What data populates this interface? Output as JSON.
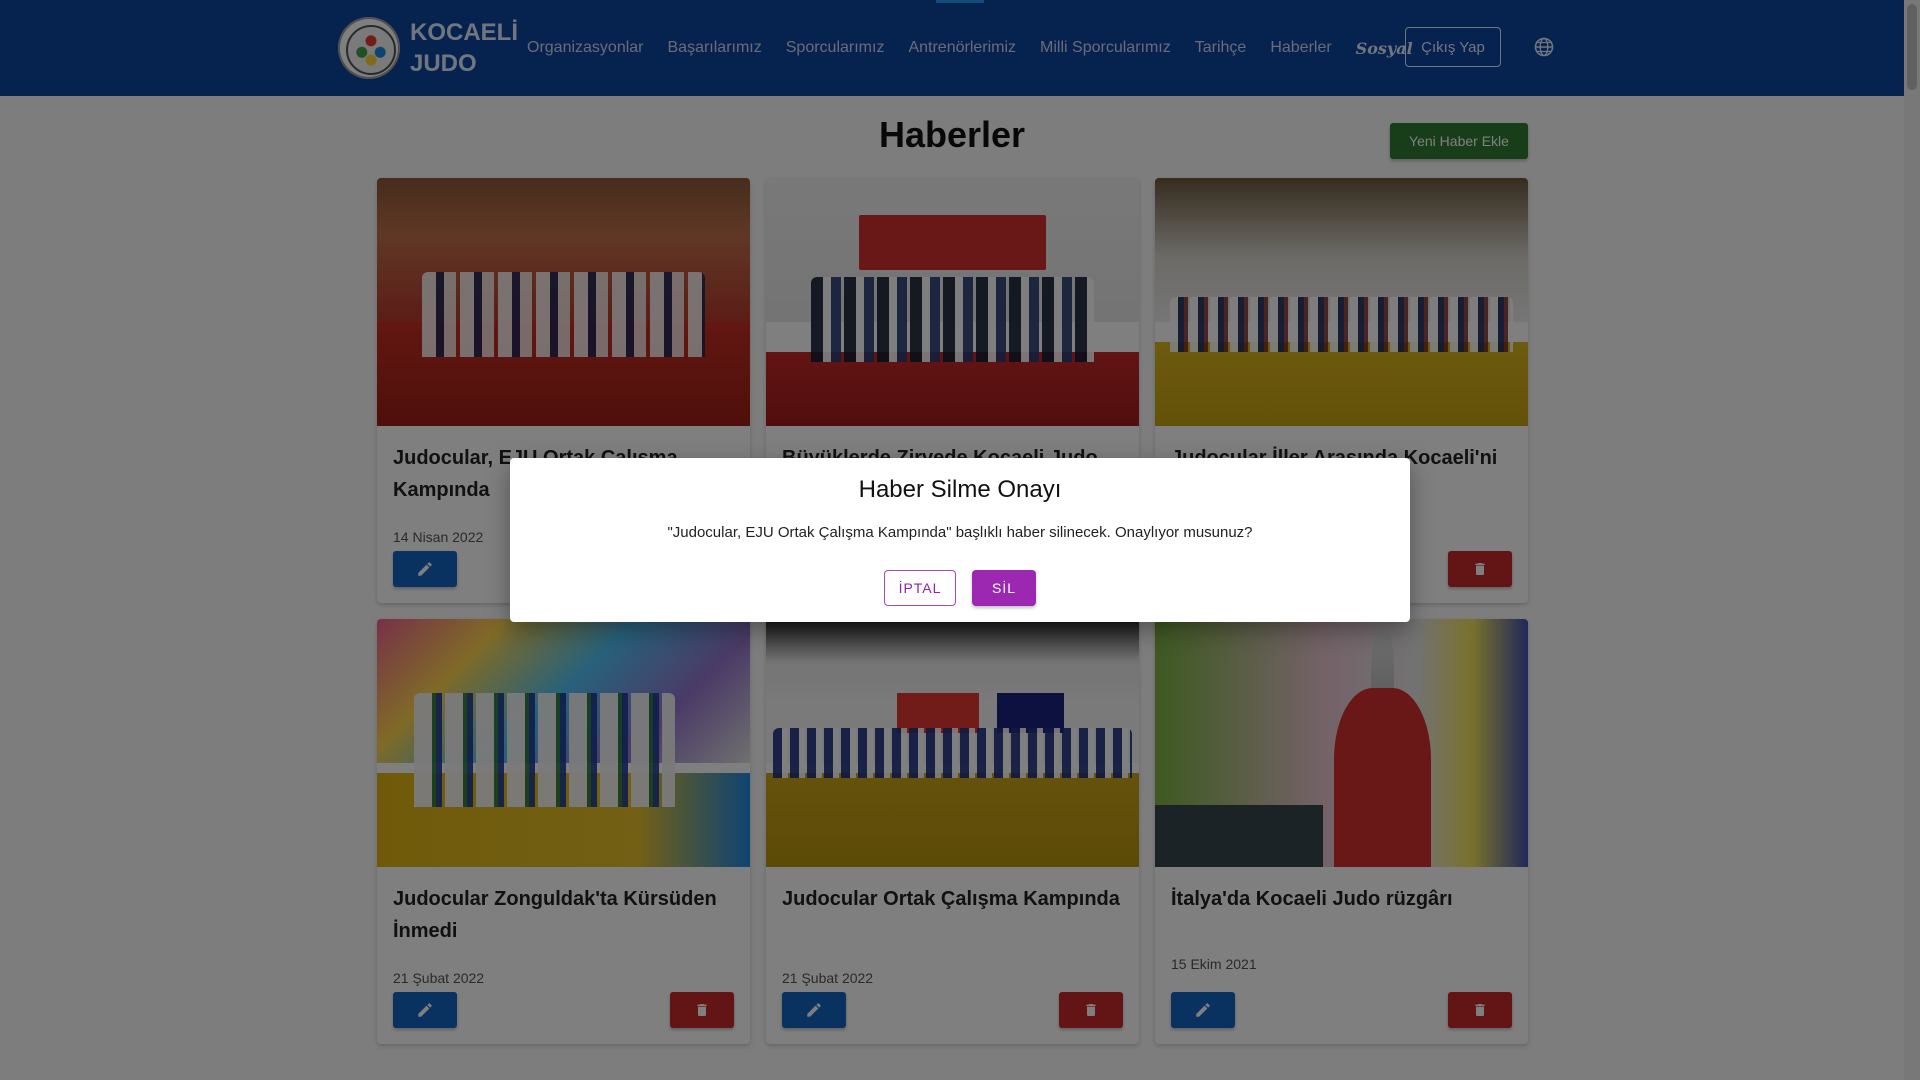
{
  "navbar": {
    "brand": "KOCAELİ\nJUDO",
    "links": [
      "Organizasyonlar",
      "Başarılarımız",
      "Sporcularımız",
      "Antrenörlerimiz",
      "Milli Sporcularımız",
      "Tarihçe",
      "Haberler",
      "Sosyal"
    ],
    "logout_label": "Çıkış Yap",
    "globe_icon": "globe-icon"
  },
  "main": {
    "title": "Haberler",
    "add_label": "Yeni Haber Ekle",
    "cards": [
      {
        "title": "Judocular, EJU Ortak Çalışma Kampında",
        "date": "14 Nisan 2022",
        "image": "red-mat-team-photo"
      },
      {
        "title": "Büyüklerde Zirvede Kocaeli Judo",
        "date": "",
        "image": "federation-banner-photo"
      },
      {
        "title": "Judocular İller Arasında Kocaeli'ni",
        "date": "",
        "image": "yellow-mat-group-photo"
      },
      {
        "title": "Judocular Zonguldak'ta Kürsüden İnmedi",
        "date": "21 Şubat 2022",
        "image": "climbing-wall-team-photo"
      },
      {
        "title": "Judocular Ortak Çalışma Kampında",
        "date": "21 Şubat 2022",
        "image": "flag-hall-group-photo"
      },
      {
        "title": "İtalya'da Kocaeli Judo rüzgârı",
        "date": "15 Ekim 2021",
        "image": "trophy-athlete-photo"
      }
    ]
  },
  "dialog": {
    "title": "Haber Silme Onayı",
    "message": "\"Judocular, EJU Ortak Çalışma Kampında\" başlıklı haber silinecek. Onaylıyor musunuz?",
    "cancel_label": "İPTAL",
    "confirm_label": "SİL"
  },
  "colors": {
    "navbar": "#0d47a1",
    "add_button": "#2e7d32",
    "edit_button": "#1565c0",
    "delete_button": "#c62828",
    "dialog_accent": "#9c27b0"
  }
}
